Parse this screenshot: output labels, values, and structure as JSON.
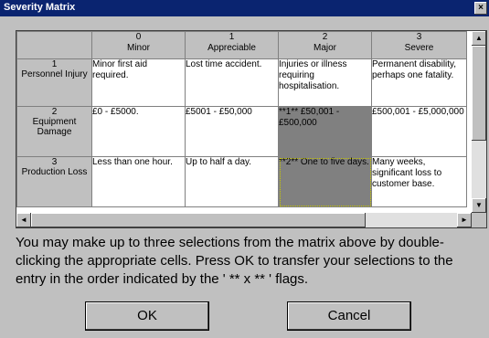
{
  "window": {
    "title": "Severity Matrix",
    "close_glyph": "×"
  },
  "grid": {
    "columns": [
      {
        "index": "0",
        "label": "Minor"
      },
      {
        "index": "1",
        "label": "Appreciable"
      },
      {
        "index": "2",
        "label": "Major"
      },
      {
        "index": "3",
        "label": "Severe"
      }
    ],
    "rows": [
      {
        "index": "1",
        "label": "Personnel Injury",
        "cells": [
          "Minor first aid required.",
          "Lost time accident.",
          "Injuries or illness requiring hospitalisation.",
          "Permanent disability, perhaps one fatality."
        ]
      },
      {
        "index": "2",
        "label": "Equipment Damage",
        "cells": [
          "£0 - £5000.",
          "£5001 - £50,000",
          "**1** £50,001 - £500,000",
          "£500,001 - £5,000,000"
        ]
      },
      {
        "index": "3",
        "label": "Production Loss",
        "cells": [
          "Less than one hour.",
          "Up to half a day.",
          "**2** One to five days.",
          "Many weeks, significant loss to customer base."
        ]
      }
    ]
  },
  "instructions": "You may make up to three selections from the matrix above by double-clicking the appropriate cells.  Press OK to transfer your selections to the entry in the order indicated  by the ' ** x ** ' flags.",
  "buttons": {
    "ok": "OK",
    "cancel": "Cancel"
  },
  "scroll": {
    "up": "▲",
    "down": "▼",
    "left": "◄",
    "right": "►"
  }
}
